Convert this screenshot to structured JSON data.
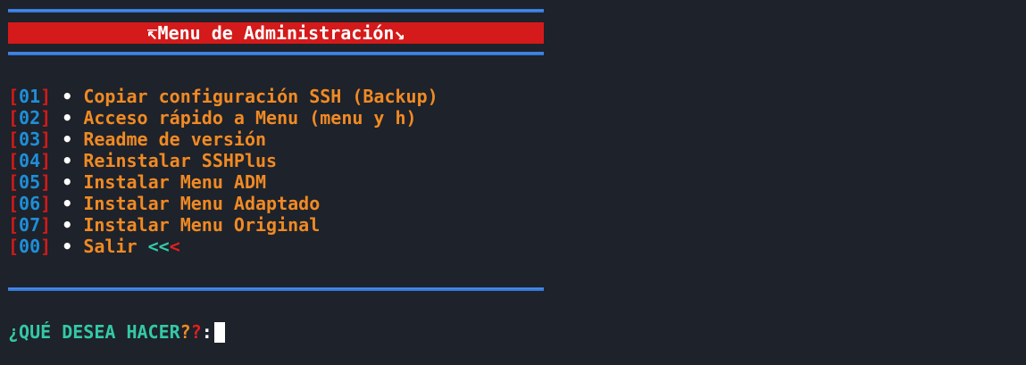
{
  "title": {
    "left_icon": "↸",
    "text": "Menu de Administración",
    "right_icon": "↘"
  },
  "menu": {
    "items": [
      {
        "num": "01",
        "label": "Copiar configuración SSH (Backup)"
      },
      {
        "num": "02",
        "label": "Acceso rápido a Menu (menu y h)"
      },
      {
        "num": "03",
        "label": "Readme de versión"
      },
      {
        "num": "04",
        "label": "Reinstalar SSHPlus"
      },
      {
        "num": "05",
        "label": "Instalar Menu ADM"
      },
      {
        "num": "06",
        "label": "Instalar Menu Adaptado"
      },
      {
        "num": "07",
        "label": "Instalar Menu Original"
      },
      {
        "num": "00",
        "label": "Salir",
        "suffix_cyan": "<<",
        "suffix_red": "<"
      }
    ],
    "bracket_open": "[",
    "bracket_close": "]",
    "bullet": "•"
  },
  "prompt": {
    "text": "¿QUÉ DESEA HACER",
    "q1": "?",
    "q2": "?",
    "colon": ":"
  },
  "colors": {
    "background": "#1e222a",
    "separator": "#3479d9",
    "title_bar": "#d41a1a",
    "bracket": "#d11a1a",
    "number": "#1e8fd9",
    "label": "#f08a24",
    "prompt": "#34c9a6"
  }
}
